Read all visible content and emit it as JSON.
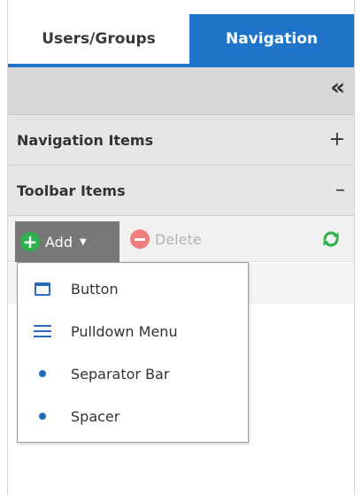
{
  "tabs": [
    {
      "label": "Users/Groups",
      "active": false
    },
    {
      "label": "Navigation",
      "active": true
    }
  ],
  "collapse_icon": {
    "glyph": "«",
    "icon": "double-chevron-left-icon"
  },
  "sections": {
    "navigation_items": {
      "title": "Navigation Items",
      "toggle": "+"
    },
    "toolbar_items": {
      "title": "Toolbar Items",
      "toggle": "–"
    }
  },
  "toolbar": {
    "add_label": "Add",
    "add_caret": "▼",
    "delete_label": "Delete",
    "refresh_icon": "refresh-icon"
  },
  "add_menu": {
    "items": [
      {
        "label": "Button",
        "icon": "button-icon"
      },
      {
        "label": "Pulldown Menu",
        "icon": "menu-lines-icon"
      },
      {
        "label": "Separator Bar",
        "icon": "bullet-icon"
      },
      {
        "label": "Spacer",
        "icon": "bullet-icon"
      }
    ]
  },
  "colors": {
    "accent": "#1f74c9",
    "add_green": "#2db24c",
    "delete_red": "#ef7f7f",
    "icon_blue": "#2a6bc2"
  }
}
